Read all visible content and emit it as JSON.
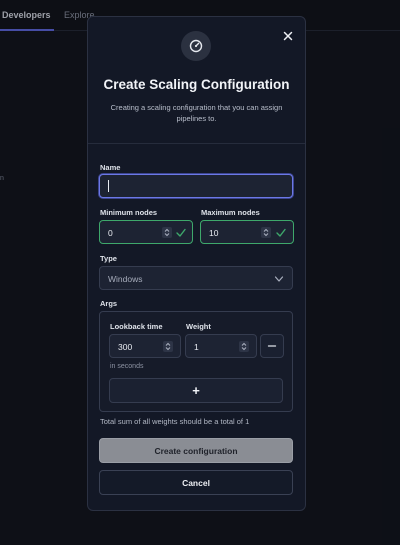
{
  "background": {
    "tabs": [
      "Developers",
      "Explore"
    ],
    "fragment": "n"
  },
  "modal": {
    "title": "Create Scaling Configuration",
    "subtitle": "Creating a scaling configuration that you can assign pipelines to.",
    "name": {
      "label": "Name",
      "value": ""
    },
    "min_nodes": {
      "label": "Minimum nodes",
      "value": "0"
    },
    "max_nodes": {
      "label": "Maximum nodes",
      "value": "10"
    },
    "type": {
      "label": "Type",
      "value": "Windows"
    },
    "args": {
      "label": "Args",
      "lookback": {
        "label": "Lookback time",
        "value": "300",
        "hint": "in seconds"
      },
      "weight": {
        "label": "Weight",
        "value": "1"
      },
      "add_symbol": "+"
    },
    "note": "Total sum of all weights should be a total of 1",
    "create_label": "Create configuration",
    "cancel_label": "Cancel"
  },
  "colors": {
    "accent": "#6c78e6",
    "valid": "#3ea86b",
    "modal_bg": "#131826"
  }
}
